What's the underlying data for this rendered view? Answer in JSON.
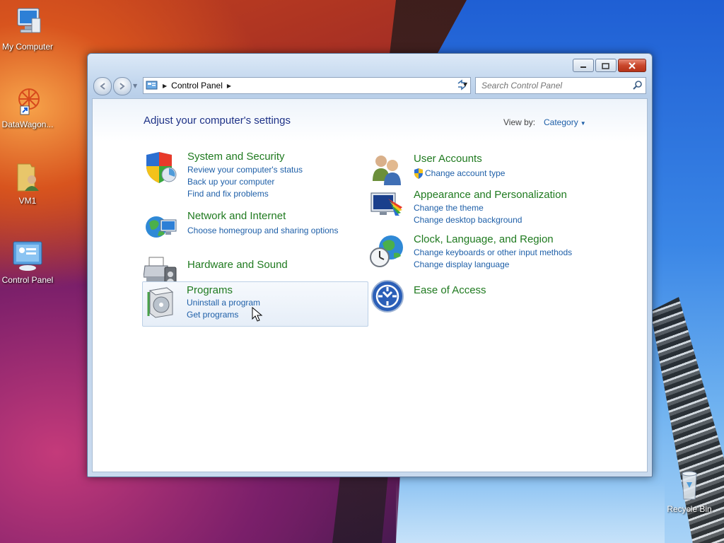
{
  "desktop": {
    "icons": [
      {
        "label": "My Computer"
      },
      {
        "label": "DataWagon..."
      },
      {
        "label": "VM1"
      },
      {
        "label": "Control Panel"
      },
      {
        "label": "Recycle Bin"
      }
    ]
  },
  "window": {
    "address": {
      "crumb": "Control Panel"
    },
    "search": {
      "placeholder": "Search Control Panel"
    },
    "page_title": "Adjust your computer's settings",
    "view_by": {
      "label": "View by:",
      "value": "Category"
    },
    "categories": [
      {
        "title": "System and Security",
        "links": [
          "Review your computer's status",
          "Back up your computer",
          "Find and fix problems"
        ]
      },
      {
        "title": "Network and Internet",
        "links": [
          "Choose homegroup and sharing options"
        ]
      },
      {
        "title": "Hardware and Sound",
        "links": []
      },
      {
        "title": "Programs",
        "links": [
          "Uninstall a program",
          "Get programs"
        ]
      },
      {
        "title": "User Accounts",
        "links": [
          "Change account type"
        ]
      },
      {
        "title": "Appearance and Personalization",
        "links": [
          "Change the theme",
          "Change desktop background"
        ]
      },
      {
        "title": "Clock, Language, and Region",
        "links": [
          "Change keyboards or other input methods",
          "Change display language"
        ]
      },
      {
        "title": "Ease of Access",
        "links": []
      }
    ]
  },
  "colors": {
    "title_green": "#1f7a1f",
    "link_blue": "#1e5fa8",
    "heading_navy": "#1e3287"
  }
}
